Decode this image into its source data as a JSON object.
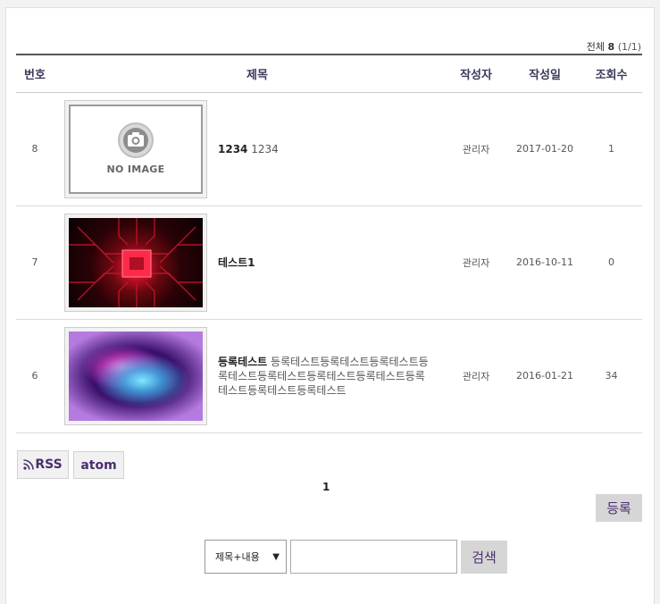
{
  "summary": {
    "total_label": "전체",
    "total_count": "8",
    "page_info": "(1/1)"
  },
  "table": {
    "headers": {
      "num": "번호",
      "title": "제목",
      "author": "작성자",
      "date": "작성일",
      "views": "조회수"
    },
    "rows": [
      {
        "num": "8",
        "thumb": "no-image",
        "noimage_text": "NO IMAGE",
        "title": "1234",
        "preview": "1234",
        "author": "관리자",
        "date": "2017-01-20",
        "views": "1"
      },
      {
        "num": "7",
        "thumb": "circuit-board-image",
        "title": "테스트1",
        "preview": "",
        "author": "관리자",
        "date": "2016-10-11",
        "views": "0"
      },
      {
        "num": "6",
        "thumb": "galaxy-nebula-image",
        "title": "등록테스트",
        "preview": "등록테스트등록테스트등록테스트등록테스트등록테스트등록테스트등록테스트등록테스트등록테스트등록테스트",
        "author": "관리자",
        "date": "2016-01-21",
        "views": "34"
      }
    ]
  },
  "feeds": {
    "rss_label": "RSS",
    "atom_label": "atom"
  },
  "pagination": {
    "current": "1"
  },
  "actions": {
    "register_label": "등록"
  },
  "search": {
    "scope_selected": "제목+내용",
    "query": "",
    "submit_label": "검색"
  },
  "colors": {
    "accent_text": "#4b2e6e",
    "header_rule": "#555555",
    "button_gray": "#d6d6d6"
  }
}
